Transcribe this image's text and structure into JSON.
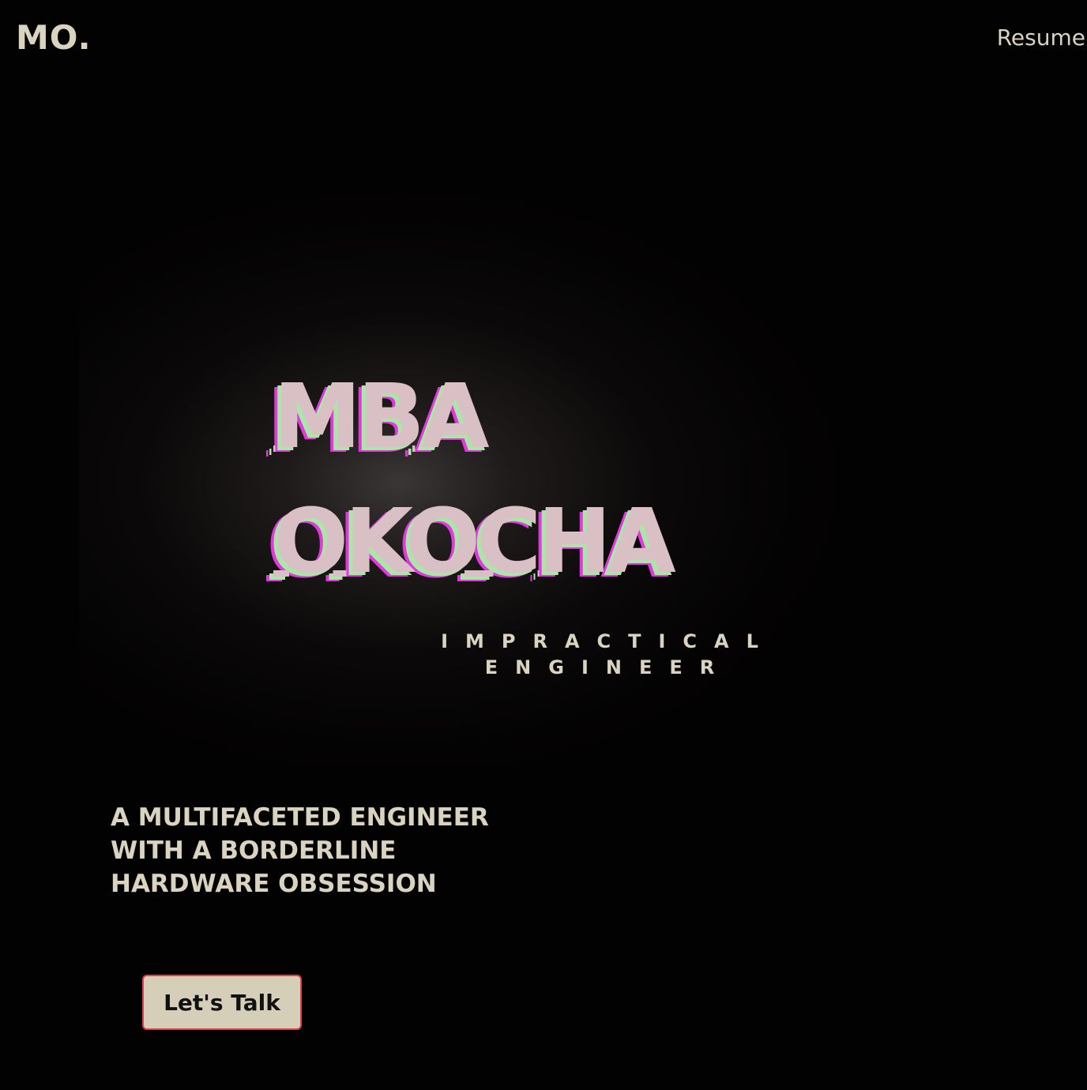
{
  "header": {
    "logo": "MO.",
    "nav": [
      {
        "label": "Resume"
      }
    ]
  },
  "hero": {
    "name_first": "MBA",
    "name_last": "OKOCHA",
    "tagline_line1": "IMPRACTICAL",
    "tagline_line2": "ENGINEER"
  },
  "bio": {
    "line1": "A MULTIFACETED ENGINEER",
    "line2": "WITH A BORDERLINE",
    "line3": "HARDWARE OBSESSION"
  },
  "cta": {
    "label": "Let's Talk"
  },
  "colors": {
    "background": "#030202",
    "text": "#d9d3c0",
    "name_fill": "#d8c0c4",
    "name_shadow_green": "#a9e7a6",
    "name_shadow_magenta": "#e437e0",
    "button_bg": "#d5cfba",
    "button_border": "#e0404a"
  }
}
